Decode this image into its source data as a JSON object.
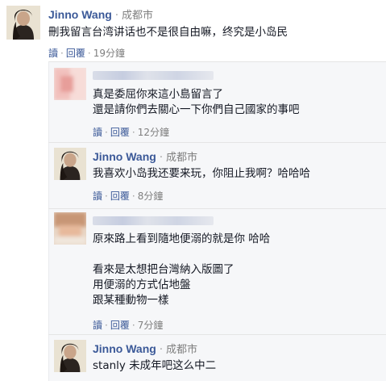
{
  "comments": [
    {
      "name": "Jinno Wang",
      "location": "成都市",
      "text": [
        "刪我留言台湾讲话也不是很自由嘛，终究是小岛民"
      ],
      "reply_label": "讀",
      "reply2_label": "回覆",
      "time": "19分鐘"
    },
    {
      "name": "",
      "location": "",
      "text": [
        "真是委屈你來這小島留言了",
        "還是請你們去關心一下你們自己國家的事吧"
      ],
      "reply_label": "讀",
      "reply2_label": "回覆",
      "time": "12分鐘"
    },
    {
      "name": "Jinno Wang",
      "location": "成都市",
      "text": [
        "我喜欢小岛我还要来玩，你阻止我啊？哈哈哈"
      ],
      "reply_label": "讀",
      "reply2_label": "回覆",
      "time": "8分鐘"
    },
    {
      "name": "",
      "location": "",
      "text": [
        "原來路上看到隨地便溺的就是你 哈哈",
        "看來是太想把台灣納入版圖了",
        "用便溺的方式佔地盤",
        "跟某種動物一樣"
      ],
      "reply_label": "讀",
      "reply2_label": "回覆",
      "time": "7分鐘"
    },
    {
      "name": "Jinno Wang",
      "location": "成都市",
      "text": [
        "stanly 未成年吧这么中二"
      ],
      "reply_label": "",
      "reply2_label": "",
      "time": ""
    }
  ],
  "colors": {
    "name_link": "#3b5998",
    "meta_gray": "#7f7f7f",
    "reply_bg": "#f6f7f9"
  },
  "icons": [
    "user-avatar-icon",
    "blurred-avatar-icon"
  ]
}
